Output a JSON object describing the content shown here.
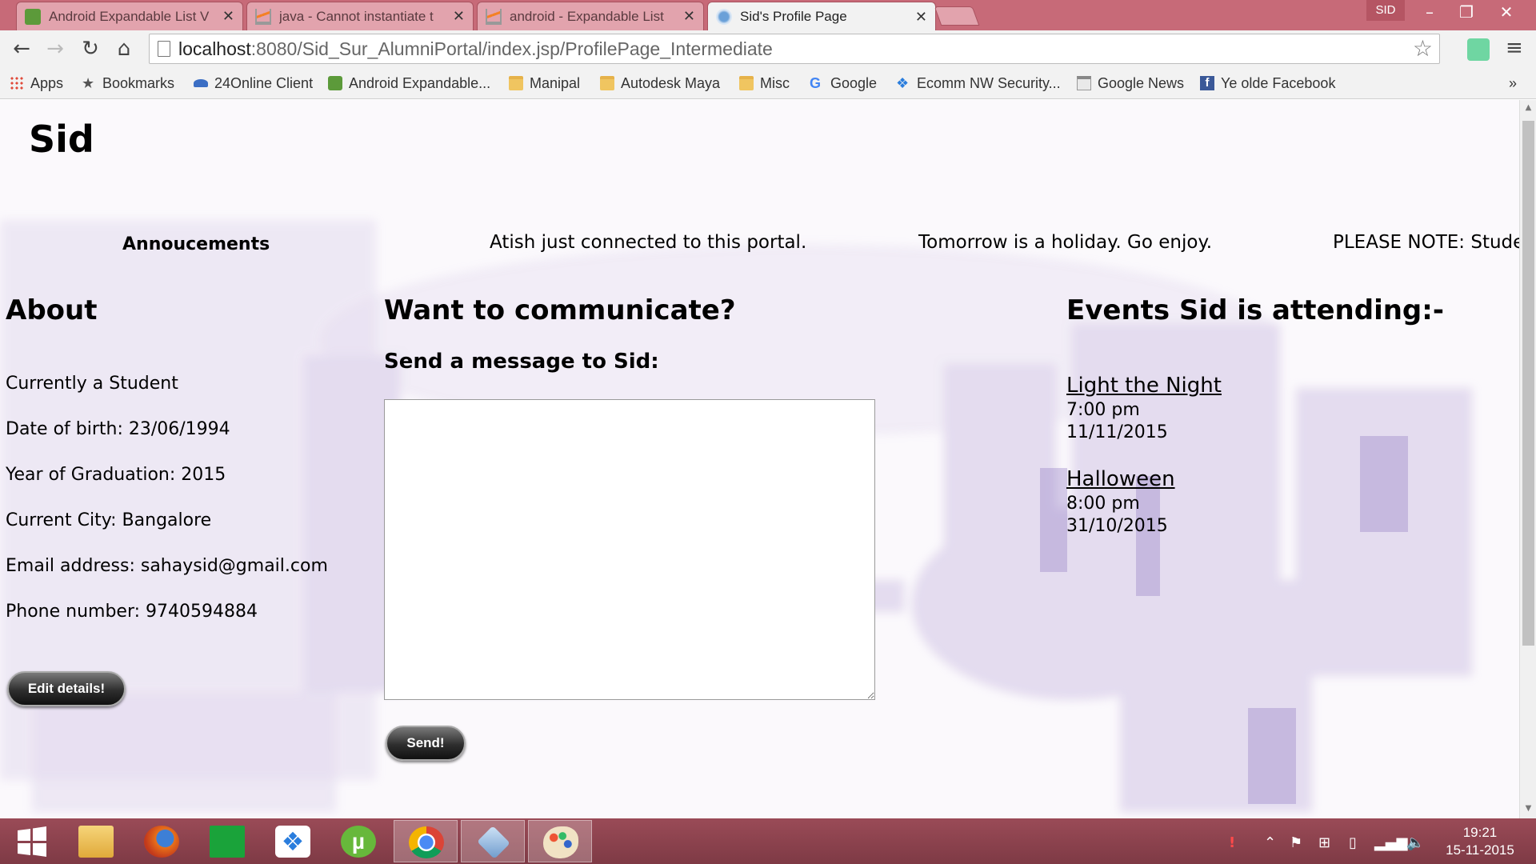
{
  "browser": {
    "tabs": [
      {
        "title": "Android Expandable List V",
        "icon": "android-favicon",
        "active": false
      },
      {
        "title": "java - Cannot instantiate t",
        "icon": "stackoverflow-favicon",
        "active": false
      },
      {
        "title": "android - Expandable List",
        "icon": "stackoverflow-favicon",
        "active": false
      },
      {
        "title": "Sid's Profile Page",
        "icon": "tomcat-favicon",
        "active": true
      }
    ],
    "profile_name": "SID",
    "url_host": "localhost",
    "url_path": ":8080/Sid_Sur_AlumniPortal/index.jsp/ProfilePage_Intermediate",
    "bookmarks": [
      {
        "label": "Apps",
        "icon": "apps-grid-icon"
      },
      {
        "label": "Bookmarks",
        "icon": "star-icon"
      },
      {
        "label": "24Online Client",
        "icon": "cloud-icon"
      },
      {
        "label": "Android Expandable...",
        "icon": "android-icon"
      },
      {
        "label": "Manipal",
        "icon": "folder-icon"
      },
      {
        "label": "Autodesk Maya",
        "icon": "folder-icon"
      },
      {
        "label": "Misc",
        "icon": "folder-icon"
      },
      {
        "label": "Google",
        "icon": "google-icon"
      },
      {
        "label": "Ecomm NW Security...",
        "icon": "dropbox-icon"
      },
      {
        "label": "Google News",
        "icon": "news-icon"
      },
      {
        "label": "Ye olde Facebook",
        "icon": "facebook-icon"
      }
    ],
    "overflow_glyph": "»"
  },
  "page": {
    "site_title": "Sid",
    "announcements": {
      "heading": "Annoucements",
      "items": [
        "Atish just connected to this portal.",
        "Tomorrow is a holiday. Go enjoy.",
        "PLEASE NOTE: Stude"
      ]
    },
    "about": {
      "heading": "About",
      "lines": [
        "Currently a Student",
        "Date of birth: 23/06/1994",
        "Year of Graduation: 2015",
        "Current City: Bangalore",
        "Email address: sahaysid@gmail.com",
        "Phone number: 9740594884"
      ],
      "edit_button": "Edit details!"
    },
    "communicate": {
      "heading": "Want to communicate?",
      "send_label": "Send a message to Sid:",
      "message_value": "",
      "send_button": "Send!"
    },
    "events": {
      "heading": "Events Sid is attending:-",
      "items": [
        {
          "name": "Light the Night",
          "time": "7:00 pm",
          "date": "11/11/2015"
        },
        {
          "name": "Halloween",
          "time": "8:00 pm",
          "date": "31/10/2015"
        }
      ]
    }
  },
  "taskbar": {
    "apps": [
      "start-icon",
      "file-explorer-icon",
      "firefox-icon",
      "store-icon",
      "dropbox-icon",
      "utorrent-icon",
      "chrome-icon",
      "cube-app-icon",
      "paint-icon"
    ],
    "clock_time": "19:21",
    "clock_date": "15-11-2015"
  },
  "colors": {
    "titlebar": "#c76a78",
    "taskbar": "#8a424e",
    "page_bg_tint": "#b9a6d8"
  }
}
